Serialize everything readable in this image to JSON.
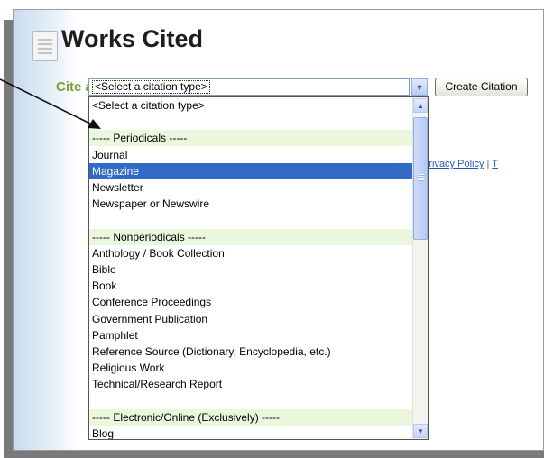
{
  "header": {
    "title": "Works Cited",
    "icon": "document-icon"
  },
  "form": {
    "cite_label": "Cite a:",
    "select_value": "<Select a citation type>",
    "create_button": "Create Citation"
  },
  "footer_links": {
    "privacy": "Privacy Policy",
    "separator": "|",
    "next": "T"
  },
  "dropdown": {
    "options": [
      {
        "label": "<Select a citation type>",
        "kind": "option"
      },
      {
        "label": "",
        "kind": "blank"
      },
      {
        "label": "----- Periodicals -----",
        "kind": "group"
      },
      {
        "label": "Journal",
        "kind": "option"
      },
      {
        "label": "Magazine",
        "kind": "selected"
      },
      {
        "label": "Newsletter",
        "kind": "option"
      },
      {
        "label": "Newspaper or Newswire",
        "kind": "option"
      },
      {
        "label": "",
        "kind": "blank"
      },
      {
        "label": "----- Nonperiodicals -----",
        "kind": "group"
      },
      {
        "label": "Anthology / Book Collection",
        "kind": "option"
      },
      {
        "label": "Bible",
        "kind": "option"
      },
      {
        "label": "Book",
        "kind": "option"
      },
      {
        "label": "Conference Proceedings",
        "kind": "option"
      },
      {
        "label": "Government Publication",
        "kind": "option"
      },
      {
        "label": "Pamphlet",
        "kind": "option"
      },
      {
        "label": "Reference Source (Dictionary, Encyclopedia, etc.)",
        "kind": "option"
      },
      {
        "label": "Religious Work",
        "kind": "option"
      },
      {
        "label": "Technical/Research Report",
        "kind": "option"
      },
      {
        "label": "",
        "kind": "blank"
      },
      {
        "label": "----- Electronic/Online (Exclusively) -----",
        "kind": "group"
      },
      {
        "label": "Blog",
        "kind": "option"
      }
    ]
  },
  "colors": {
    "accent_green": "#7ea33a",
    "selection_blue": "#3169c6",
    "group_bg": "#eaf7dc"
  }
}
